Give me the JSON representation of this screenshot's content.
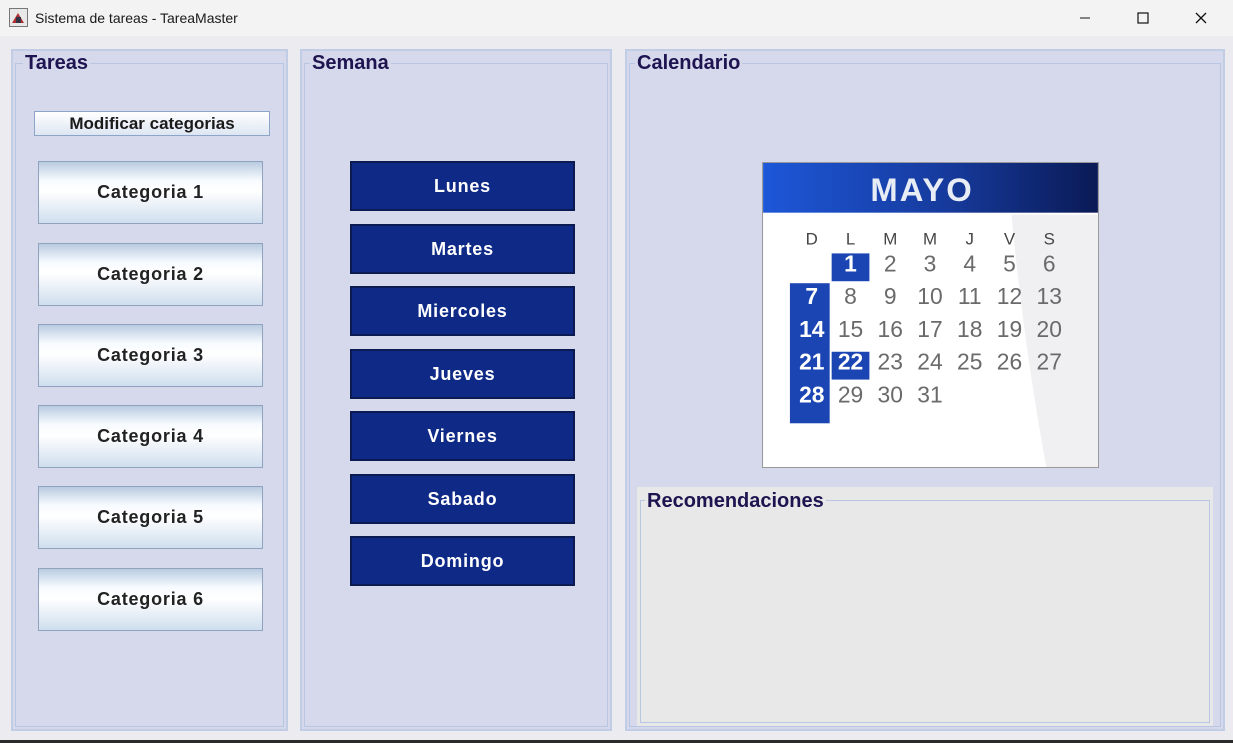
{
  "window": {
    "title": "Sistema de tareas - TareaMaster"
  },
  "tareas": {
    "title": "Tareas",
    "modify_label": "Modificar categorias",
    "categories": [
      "Categoria 1",
      "Categoria 2",
      "Categoria 3",
      "Categoria 4",
      "Categoria 5",
      "Categoria 6"
    ]
  },
  "semana": {
    "title": "Semana",
    "days": [
      "Lunes",
      "Martes",
      "Miercoles",
      "Jueves",
      "Viernes",
      "Sabado",
      "Domingo"
    ]
  },
  "calendario": {
    "title": "Calendario",
    "month": "MAYO",
    "weekdays": [
      "D",
      "L",
      "M",
      "M",
      "J",
      "V",
      "S"
    ],
    "dates": [
      "1",
      "2",
      "3",
      "4",
      "5",
      "6",
      "7",
      "8",
      "9",
      "10",
      "11",
      "12",
      "13",
      "14",
      "15",
      "16",
      "17",
      "18",
      "19",
      "20",
      "21",
      "22",
      "23",
      "24",
      "25",
      "26",
      "27",
      "28",
      "29",
      "30",
      "31"
    ],
    "highlight_color": "#1a45b3"
  },
  "recomendaciones": {
    "title": "Recomendaciones"
  }
}
